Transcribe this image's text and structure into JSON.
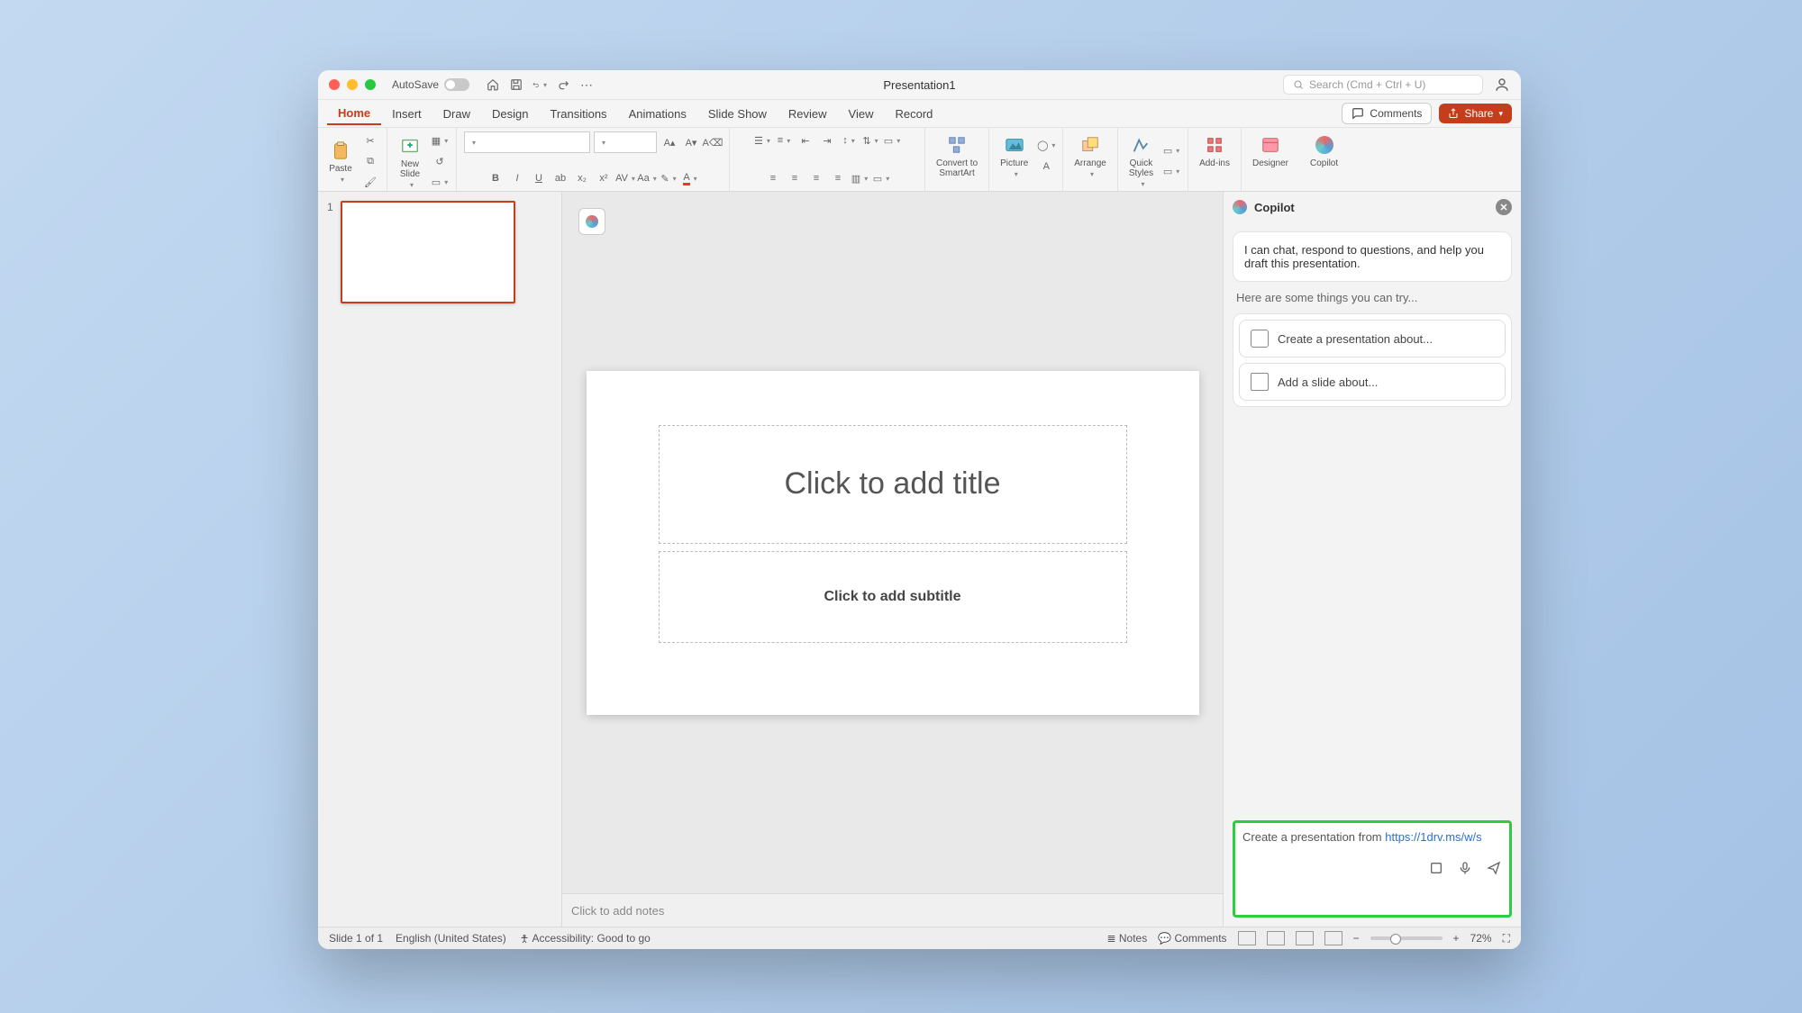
{
  "titlebar": {
    "autosave_label": "AutoSave",
    "doc_title": "Presentation1",
    "search_placeholder": "Search (Cmd + Ctrl + U)"
  },
  "tabs": {
    "items": [
      "Home",
      "Insert",
      "Draw",
      "Design",
      "Transitions",
      "Animations",
      "Slide Show",
      "Review",
      "View",
      "Record"
    ],
    "active": "Home",
    "comments_label": "Comments",
    "share_label": "Share"
  },
  "ribbon": {
    "paste": "Paste",
    "new_slide": "New\nSlide",
    "convert": "Convert to\nSmartArt",
    "picture": "Picture",
    "arrange": "Arrange",
    "quick_styles": "Quick\nStyles",
    "addins": "Add-ins",
    "designer": "Designer",
    "copilot": "Copilot"
  },
  "slide": {
    "number": "1",
    "title_placeholder": "Click to add title",
    "subtitle_placeholder": "Click to add subtitle",
    "notes_placeholder": "Click to add notes"
  },
  "copilot": {
    "title": "Copilot",
    "intro": "I can chat, respond to questions, and help you draft this presentation.",
    "hint": "Here are some things you can try...",
    "sugg1": "Create a presentation about...",
    "sugg2": "Add a slide about...",
    "input_prefix": "Create a presentation from ",
    "input_url": "https://1drv.ms/w/s"
  },
  "statusbar": {
    "slide_info": "Slide 1 of 1",
    "language": "English (United States)",
    "accessibility": "Accessibility: Good to go",
    "notes": "Notes",
    "comments": "Comments",
    "zoom": "72%"
  }
}
